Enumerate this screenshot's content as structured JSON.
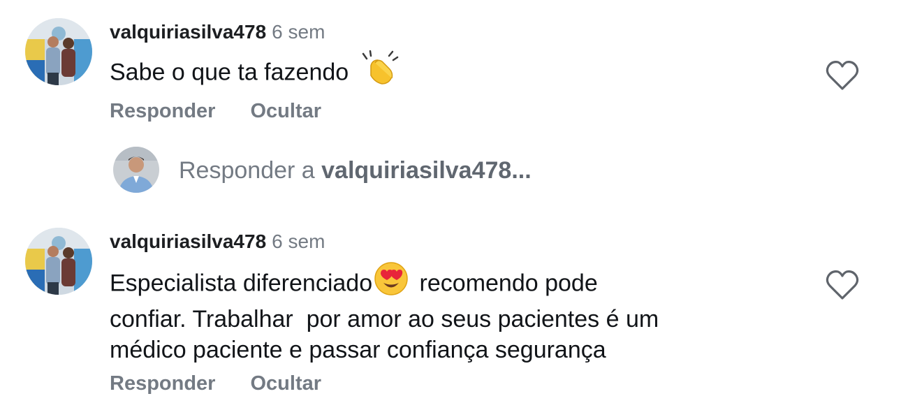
{
  "comments": [
    {
      "username": "valquiriasilva478",
      "time": "6 sem",
      "text": "Sabe o que ta fazendo",
      "emoji": "clapping-hands",
      "actions": {
        "reply": "Responder",
        "hide": "Ocultar"
      }
    },
    {
      "username": "valquiriasilva478",
      "time": "6 sem",
      "text_line1_a": "Especialista diferenciado",
      "text_line1_b": " recomendo pode",
      "text_line2": "confiar. Trabalhar  por amor ao seus pacientes é um",
      "text_line3": "médico paciente e passar confiança segurança",
      "emoji": "heart-eyes",
      "actions": {
        "reply": "Responder",
        "hide": "Ocultar"
      }
    }
  ],
  "reply_prompt": {
    "prefix": "Responder a ",
    "target": "valquiriasilva478..."
  },
  "colors": {
    "text": "#111418",
    "muted": "#737a83"
  }
}
